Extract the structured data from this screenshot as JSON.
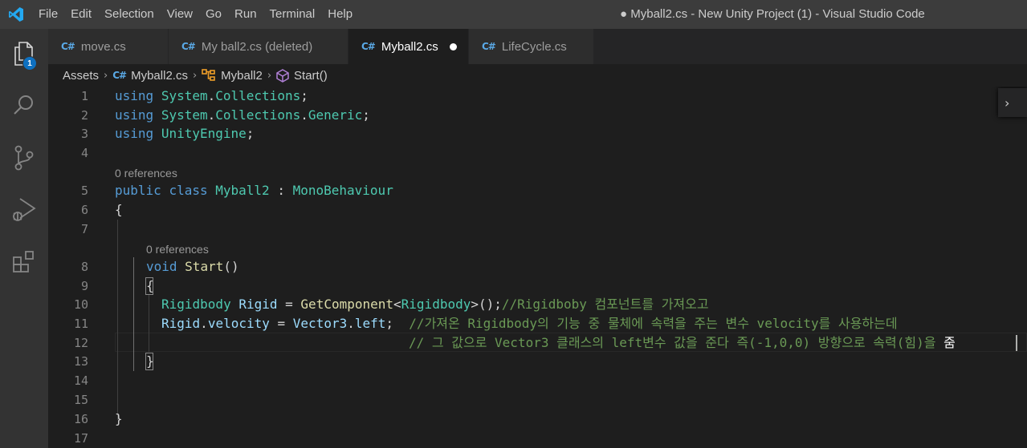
{
  "window": {
    "title": "● Myball2.cs - New Unity Project (1) - Visual Studio Code",
    "app_icon": "vscode-logo-icon",
    "brand_color": "#23a9f2"
  },
  "menu": [
    "File",
    "Edit",
    "Selection",
    "View",
    "Go",
    "Run",
    "Terminal",
    "Help"
  ],
  "activity_bar": {
    "items": [
      "explorer-icon",
      "search-icon",
      "source-control-icon",
      "run-debug-icon",
      "extensions-icon"
    ],
    "explorer_badge": "1"
  },
  "tabs": [
    {
      "label": "move.cs",
      "icon": "csharp-file-icon",
      "active": false
    },
    {
      "label": "My ball2.cs (deleted)",
      "icon": "csharp-file-icon",
      "active": false
    },
    {
      "label": "Myball2.cs",
      "icon": "csharp-file-icon",
      "active": true,
      "modified": true
    },
    {
      "label": "LifeCycle.cs",
      "icon": "csharp-file-icon",
      "active": false
    }
  ],
  "breadcrumb": {
    "folder": "Assets",
    "file": "Myball2.cs",
    "class": "Myball2",
    "method": "Start()"
  },
  "editor": {
    "line_numbers": [
      "1",
      "2",
      "3",
      "4",
      "5",
      "6",
      "7",
      "8",
      "9",
      "10",
      "11",
      "12",
      "13",
      "14",
      "15",
      "16",
      "17"
    ],
    "codelens_class": "0 references",
    "codelens_method": "0 references",
    "lines": {
      "l1": {
        "kw": "using",
        "ns1": "System",
        "p1": ".",
        "ns2": "Collections",
        "end": ";"
      },
      "l2": {
        "kw": "using",
        "ns1": "System",
        "p1": ".",
        "ns2": "Collections",
        "p2": ".",
        "ns3": "Generic",
        "end": ";"
      },
      "l3": {
        "kw": "using",
        "ns1": "UnityEngine",
        "end": ";"
      },
      "l5": {
        "kw1": "public",
        "kw2": "class",
        "name": "Myball2",
        "colon": " : ",
        "base": "MonoBehaviour"
      },
      "l6": "{",
      "l8": {
        "kw": "void",
        "fn": "Start",
        "paren": "()"
      },
      "l9": "{",
      "l10": {
        "ty": "Rigidbody",
        "var": "Rigid",
        "eq": " = ",
        "fn": "GetComponent",
        "lt": "<",
        "ty2": "Rigidbody",
        "gt": ">();",
        "cm": "//Rigidboby 컴포넌트를 가져오고"
      },
      "l11": {
        "var": "Rigid",
        "dot": ".",
        "prop": "velocity",
        "eq": " = ",
        "ty": "Vector3",
        "dot2": ".",
        "prop2": "left",
        "end": ";",
        "cm": "//가져온 Rigidbody의 기능 중 물체에 속력을 주는 변수 velocity를 사용하는데"
      },
      "l12": {
        "cm": "// 그 값으로 Vector3 클래스의 left변수 값을 준다 즉(-1,0,0) 방향으로 속력(힘)을 ",
        "composing": "줌"
      },
      "l13": "}",
      "l16": "}"
    }
  },
  "colors": {
    "keyword": "#569cd6",
    "type": "#4ec9b0",
    "function": "#dcdcaa",
    "variable": "#9cdcfe",
    "comment": "#6a9955",
    "accent_badge": "#0e70c0"
  }
}
